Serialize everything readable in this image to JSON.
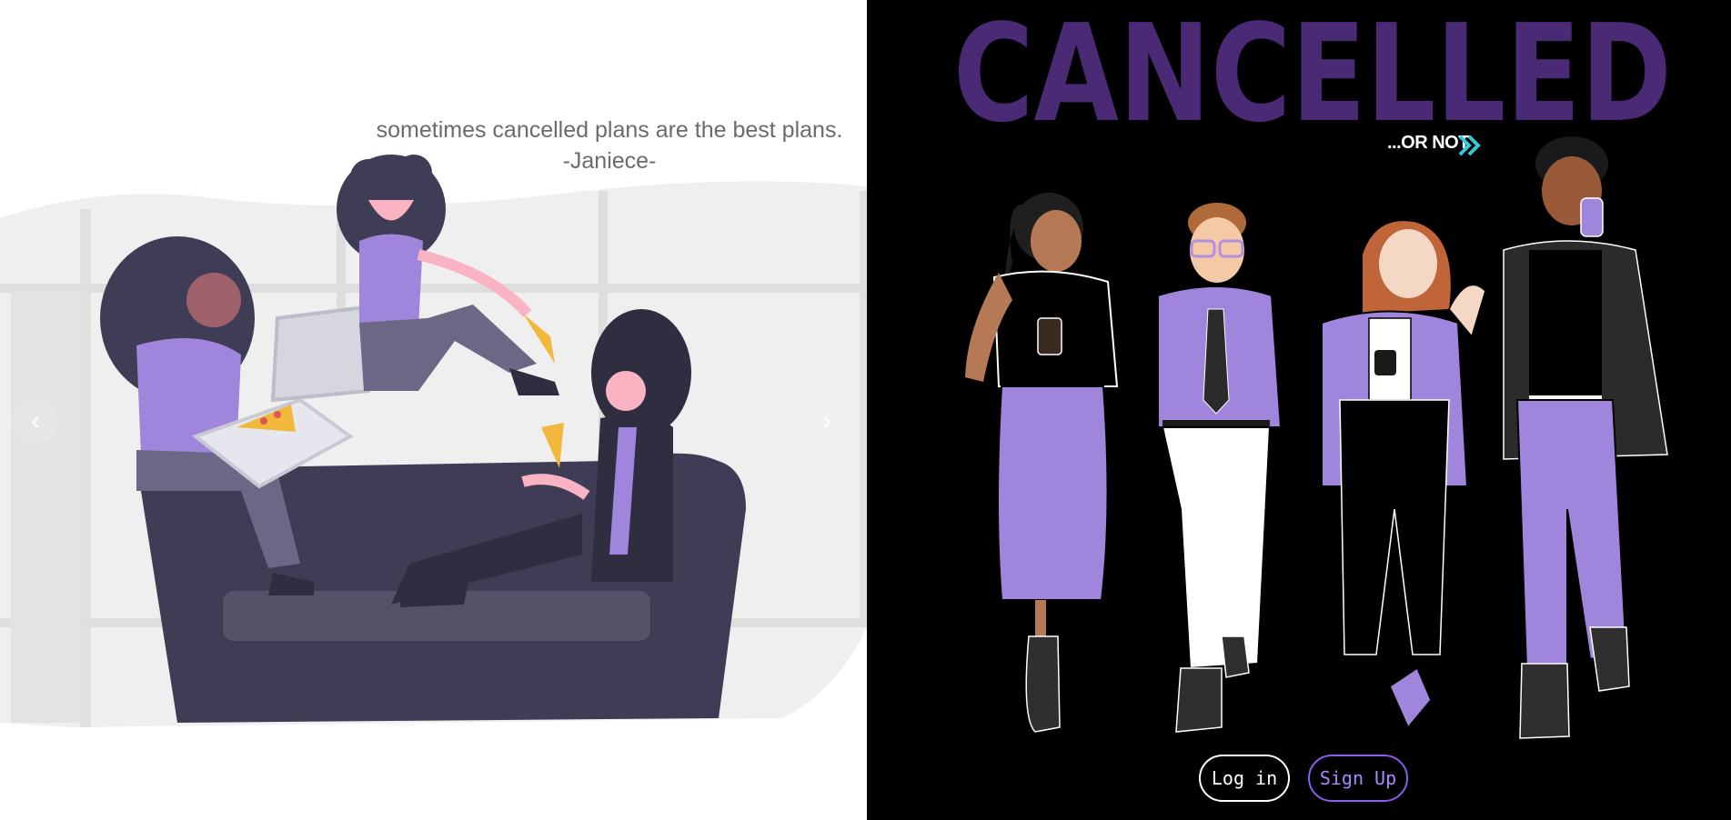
{
  "carousel": {
    "quote_line": "sometimes cancelled plans are the best plans.",
    "quote_author": "-Janiece-",
    "prev_icon": "chevron-left-icon",
    "next_icon": "chevron-right-icon",
    "prev_glyph": "‹",
    "next_glyph": "›"
  },
  "hero": {
    "brand": "CANCELLED",
    "tagline": "...OR NOT",
    "tagline_icon": "double-chevron-right-icon",
    "login_label": "Log in",
    "signup_label": "Sign Up"
  },
  "colors": {
    "brand_purple": "#4b2a75",
    "accent_lavender": "#9f85db",
    "teal": "#33c9d6",
    "signup_border": "#8a5cf0"
  }
}
